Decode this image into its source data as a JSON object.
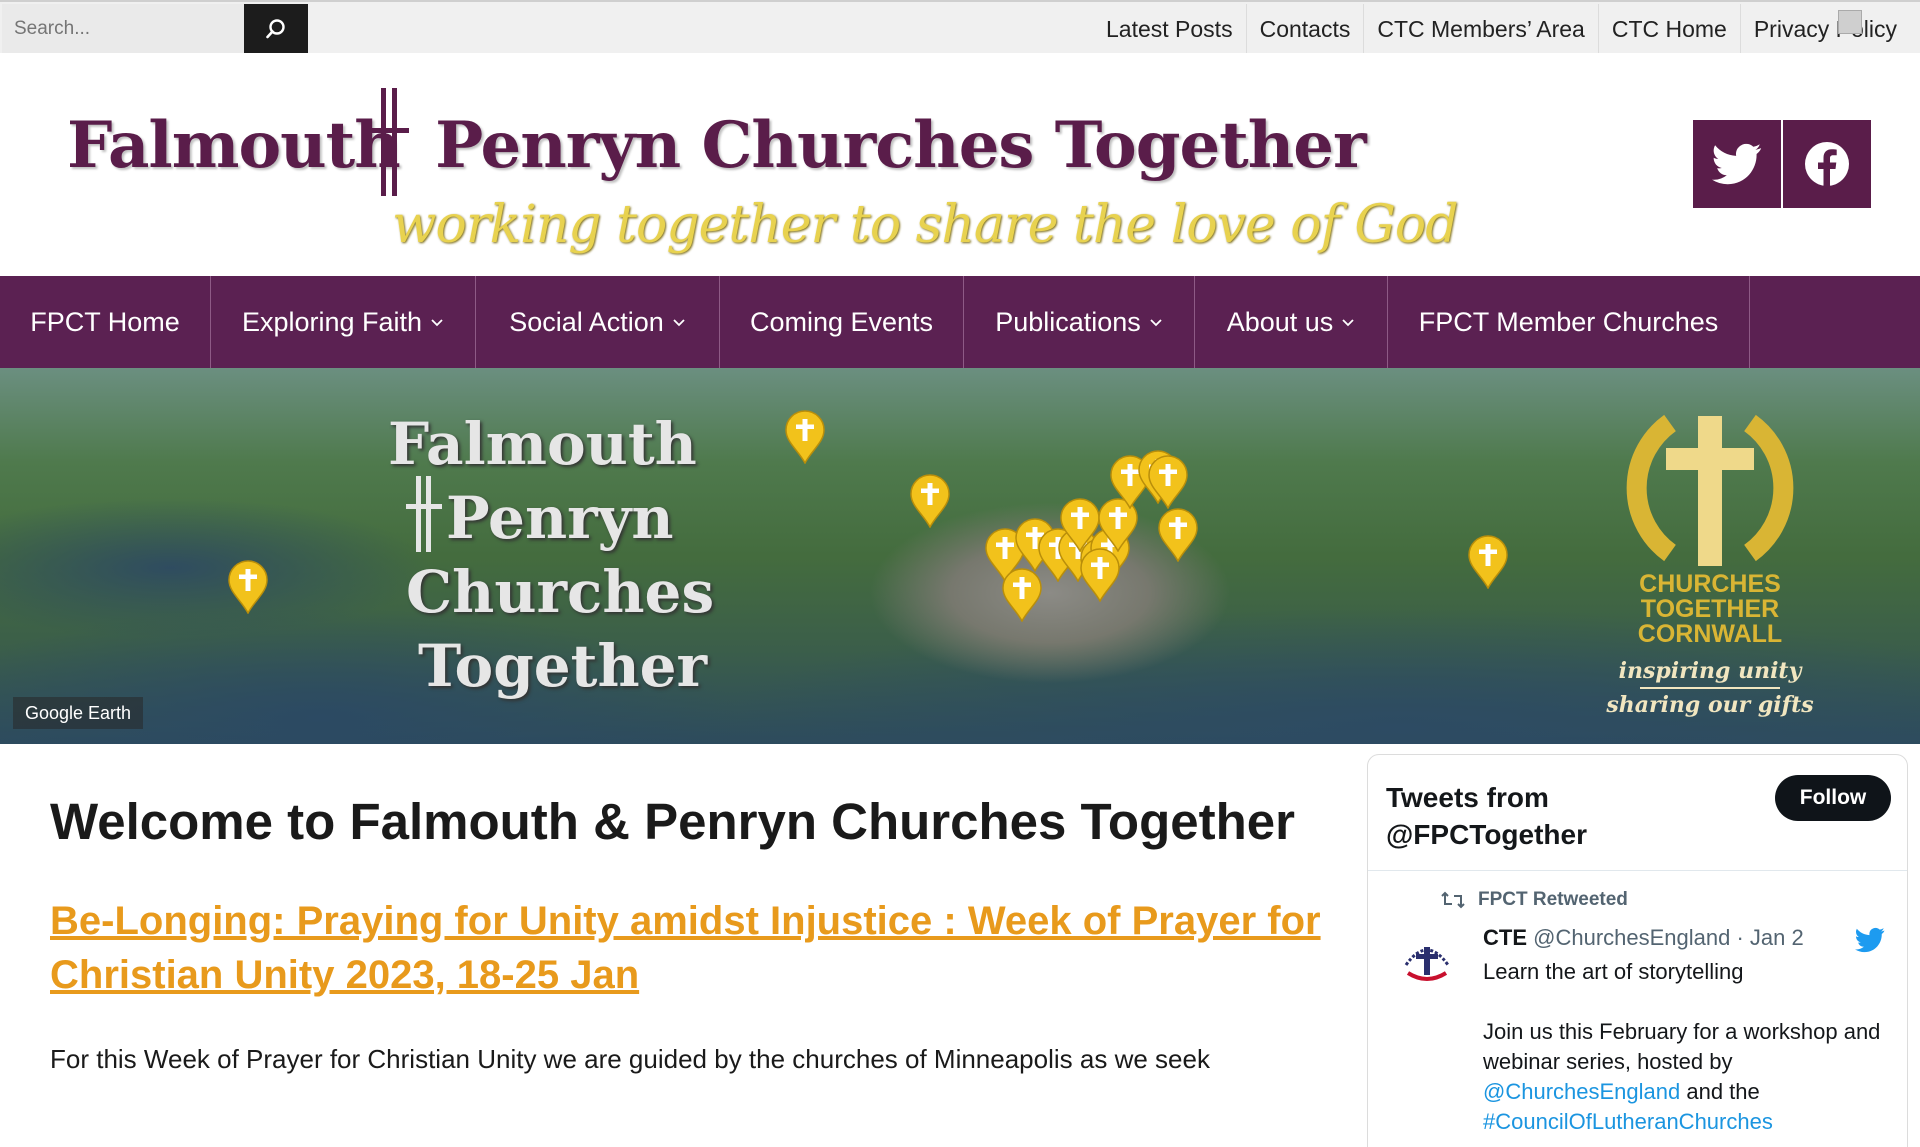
{
  "search": {
    "placeholder": "Search..."
  },
  "top_nav": [
    "Latest Posts",
    "Contacts",
    "CTC Members’ Area",
    "CTC Home",
    "Privacy Policy"
  ],
  "header": {
    "title": "Falmouth   Penryn Churches Together",
    "tagline": "working together to share the love of God",
    "social": [
      "twitter-icon",
      "facebook-icon"
    ]
  },
  "main_nav": [
    {
      "label": "FPCT Home",
      "has_dropdown": false
    },
    {
      "label": "Exploring Faith",
      "has_dropdown": true
    },
    {
      "label": "Social Action",
      "has_dropdown": true
    },
    {
      "label": "Coming Events",
      "has_dropdown": false
    },
    {
      "label": "Publications",
      "has_dropdown": true
    },
    {
      "label": "About us",
      "has_dropdown": true
    },
    {
      "label": "FPCT Member Churches",
      "has_dropdown": false
    }
  ],
  "banner": {
    "lines": [
      "Falmouth",
      "Penryn",
      "Churches",
      "Together"
    ],
    "map_credit": "Google Earth",
    "ctc": {
      "name_lines": [
        "CHURCHES",
        "TOGETHER",
        "CORNWALL"
      ],
      "motto_lines": [
        "inspiring unity",
        "sharing our gifts"
      ]
    }
  },
  "content": {
    "page_title": "Welcome to Falmouth & Penryn Churches Together",
    "post_title": "Be-Longing: Praying for Unity amidst Injustice : Week of Prayer for Christian Unity 2023, 18-25 Jan",
    "excerpt": "For this Week of Prayer for Christian Unity we are guided by the churches of Minneapolis as we seek"
  },
  "twitter": {
    "title_line1": "Tweets from",
    "title_line2": "@FPCTogether",
    "follow_label": "Follow",
    "retweeted_label": "FPCT Retweeted",
    "author_name": "CTE",
    "author_handle": "@ChurchesEngland · Jan 2",
    "line1": "Learn the art of storytelling",
    "line2": "Join us this February for a workshop and",
    "line3": "webinar series, hosted by",
    "line4_link": "@ChurchesEngland",
    "line4_text": " and the",
    "line5_link": "#CouncilOfLutheranChurches"
  },
  "colors": {
    "brand_purple": "#5b2152",
    "tagline_yellow": "#e8d24f",
    "link_orange": "#e89a1c",
    "twitter_blue": "#1b95e0",
    "ctc_gold": "#d9b534"
  }
}
